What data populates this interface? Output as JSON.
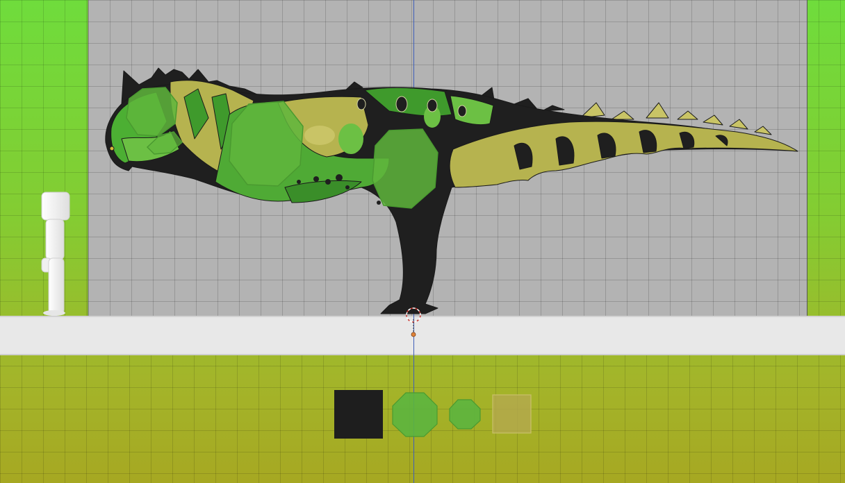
{
  "viewport": {
    "name": "3d-viewport",
    "background_top": "#6fdc3c",
    "background_bottom": "#a6a822",
    "reference_plane_color": "#b3b3b3",
    "floor_color": "#e8e8e8",
    "axis_color": "#3f5fb8"
  },
  "model": {
    "subject": "dinosaur-model",
    "colors": {
      "black": "#1f1f1f",
      "dark_green": "#3f9a2c",
      "mid_green": "#5fb33f",
      "olive": "#b6b34f",
      "light_olive": "#c9c466",
      "scale_plate": "#5fb63c"
    }
  },
  "reference_figure": {
    "subject": "human-scale-figure",
    "color": "#f2f2f2"
  },
  "cursor": {
    "subject": "3d-cursor",
    "ring_color": "#c8322b"
  },
  "palette": [
    {
      "name": "swatch-black",
      "color": "#1e1e1e",
      "shape": "square"
    },
    {
      "name": "swatch-green-large",
      "color": "#5cb53f",
      "shape": "octagon"
    },
    {
      "name": "swatch-green-small",
      "color": "#5cb53f",
      "shape": "octagon"
    },
    {
      "name": "swatch-olive",
      "color": "#b4a94f",
      "shape": "square"
    }
  ]
}
